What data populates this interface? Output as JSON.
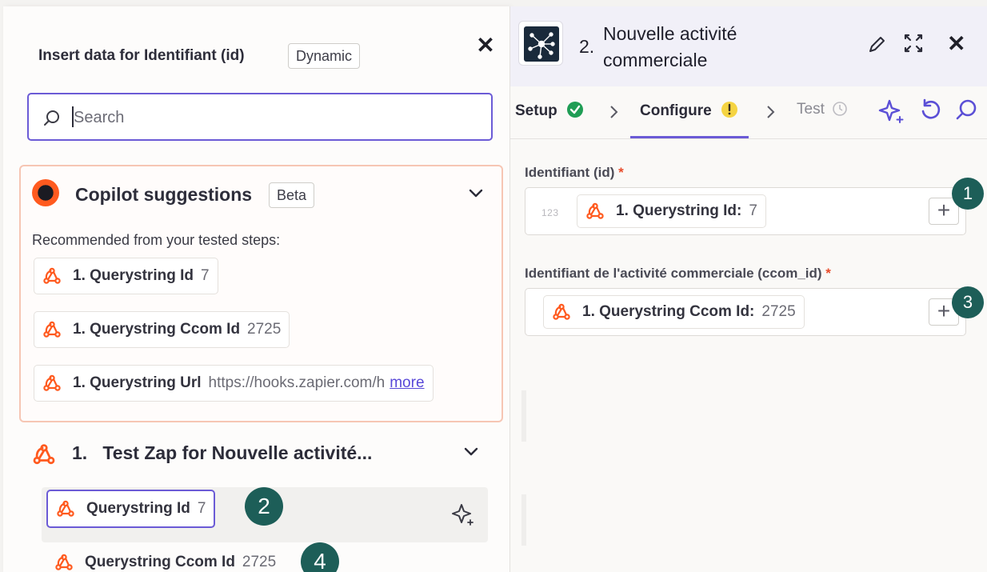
{
  "left_panel": {
    "title": "Insert data for Identifiant (id)",
    "title_badge": "Dynamic",
    "search": {
      "placeholder": "Search",
      "value": ""
    },
    "copilot": {
      "title": "Copilot suggestions",
      "badge": "Beta",
      "recommended_text": "Recommended from your tested steps:",
      "items": [
        {
          "label": "1. Querystring Id",
          "value": "7"
        },
        {
          "label": "1. Querystring Ccom Id",
          "value": "2725"
        },
        {
          "label": "1. Querystring Url",
          "value": "https://hooks.zapier.com/h",
          "more": "more"
        }
      ]
    },
    "section": {
      "number": "1.",
      "title": "Test Zap for Nouvelle activité...",
      "items": [
        {
          "label": "Querystring Id",
          "value": "7",
          "annotation": "2"
        },
        {
          "label": "Querystring Ccom Id",
          "value": "2725",
          "annotation": "4"
        }
      ]
    }
  },
  "right_panel": {
    "step_number": "2.",
    "step_title": "Nouvelle activité commerciale",
    "tabs": [
      {
        "label": "Setup",
        "status": "complete"
      },
      {
        "label": "Configure",
        "status": "warning"
      },
      {
        "label": "Test",
        "status": "pending"
      }
    ],
    "fields": [
      {
        "label": "Identifiant (id)",
        "required_mark": "*",
        "type_hint": "123",
        "pill_label": "1. Querystring Id:",
        "pill_value": "7",
        "annotation": "1"
      },
      {
        "label": "Identifiant de l'activité commerciale (ccom_id)",
        "required_mark": "*",
        "pill_label": "1. Querystring Ccom Id:",
        "pill_value": "2725",
        "annotation": "3"
      }
    ]
  },
  "colors": {
    "accent": "#6b5bd6",
    "zapier_orange": "#ff4f00",
    "annotation": "#1d5e58",
    "success": "#1f9d55",
    "warning": "#f5c518"
  },
  "icons": [
    "close-icon",
    "search-icon",
    "copilot-logo-icon",
    "chevron-down-icon",
    "webhook-icon",
    "sparkle-icon",
    "app-network-icon",
    "pencil-icon",
    "expand-icon",
    "check-circle-icon",
    "warning-icon",
    "clock-icon",
    "undo-icon",
    "plus-icon"
  ]
}
